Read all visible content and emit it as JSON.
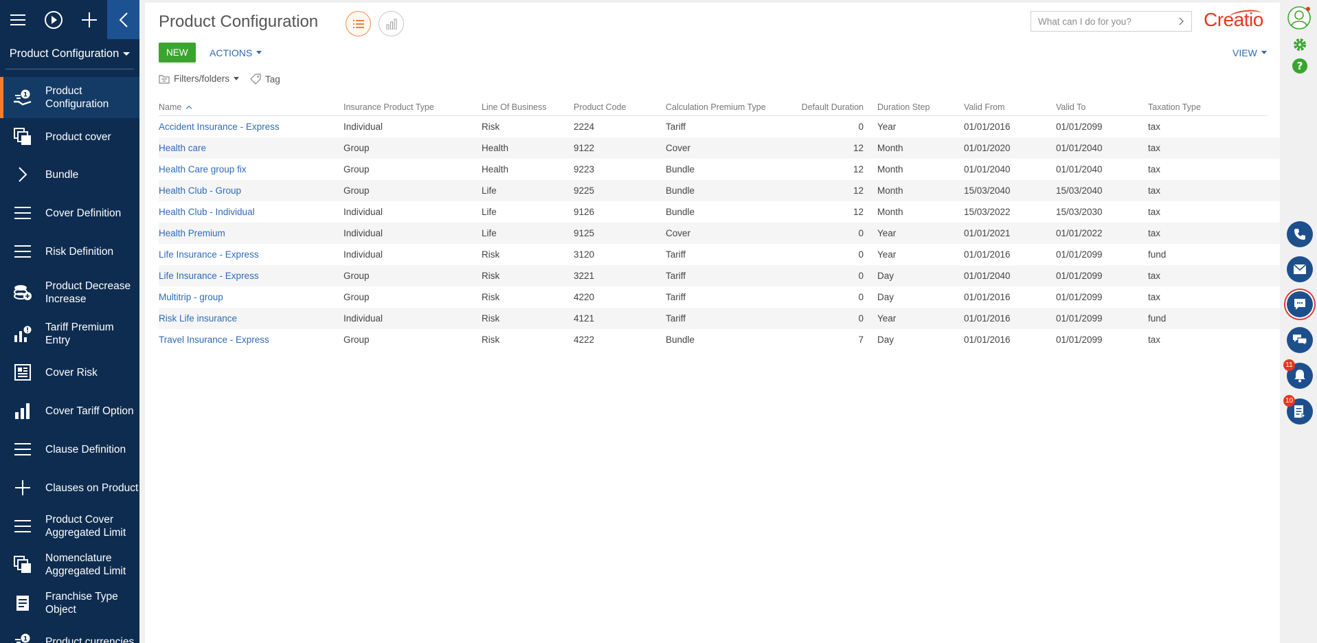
{
  "sidebar": {
    "workspace": "Product Configuration",
    "items": [
      {
        "label": "Product Configuration",
        "icon": "product-hand-icon",
        "active": true
      },
      {
        "label": "Product cover",
        "icon": "stack-icon"
      },
      {
        "label": "Bundle",
        "icon": "chevron-right-icon"
      },
      {
        "label": "Cover Definition",
        "icon": "list-icon"
      },
      {
        "label": "Risk Definition",
        "icon": "list-icon"
      },
      {
        "label": "Product Decrease Increase",
        "icon": "coins-icon"
      },
      {
        "label": "Tariff Premium Entry",
        "icon": "chart-alert-icon"
      },
      {
        "label": "Cover Risk",
        "icon": "newspaper-icon"
      },
      {
        "label": "Cover Tariff Option",
        "icon": "bar-chart-icon"
      },
      {
        "label": "Clause Definition",
        "icon": "list-icon"
      },
      {
        "label": "Clauses on Product",
        "icon": "plus-icon"
      },
      {
        "label": "Product Cover Aggregated Limit",
        "icon": "list-icon"
      },
      {
        "label": "Nomenclature Aggregated Limit",
        "icon": "stack-icon"
      },
      {
        "label": "Franchise Type Object",
        "icon": "document-icon"
      },
      {
        "label": "Product currencies",
        "icon": "product-hand-icon"
      }
    ]
  },
  "header": {
    "title": "Product Configuration",
    "search_placeholder": "What can I do for you?",
    "logo": "Creatio"
  },
  "toolbar": {
    "new_label": "NEW",
    "actions_label": "ACTIONS",
    "view_label": "VIEW",
    "filters_label": "Filters/folders",
    "tag_label": "Tag"
  },
  "grid": {
    "columns": [
      "Name",
      "Insurance Product Type",
      "Line Of Business",
      "Product Code",
      "Calculation Premium Type",
      "Default Duration",
      "Duration Step",
      "Valid From",
      "Valid To",
      "Taxation Type"
    ],
    "rows": [
      [
        "Accident Insurance - Express",
        "Individual",
        "Risk",
        "2224",
        "Tariff",
        "0",
        "Year",
        "01/01/2016",
        "01/01/2099",
        "tax"
      ],
      [
        "Health care",
        "Group",
        "Health",
        "9122",
        "Cover",
        "12",
        "Month",
        "01/01/2020",
        "01/01/2040",
        "tax"
      ],
      [
        "Health Care group fix",
        "Group",
        "Health",
        "9223",
        "Bundle",
        "12",
        "Month",
        "01/01/2040",
        "01/01/2040",
        "tax"
      ],
      [
        "Health Club - Group",
        "Group",
        "Life",
        "9225",
        "Bundle",
        "12",
        "Month",
        "15/03/2040",
        "15/03/2040",
        "tax"
      ],
      [
        "Health Club - Individual",
        "Individual",
        "Life",
        "9126",
        "Bundle",
        "12",
        "Month",
        "15/03/2022",
        "15/03/2030",
        "tax"
      ],
      [
        "Health Premium",
        "Individual",
        "Life",
        "9125",
        "Cover",
        "0",
        "Year",
        "01/01/2021",
        "01/01/2022",
        "tax"
      ],
      [
        "Life Insurance - Express",
        "Individual",
        "Risk",
        "3120",
        "Tariff",
        "0",
        "Year",
        "01/01/2016",
        "01/01/2099",
        "fund"
      ],
      [
        "Life Insurance - Express",
        "Group",
        "Risk",
        "3221",
        "Tariff",
        "0",
        "Day",
        "01/01/2040",
        "01/01/2099",
        "tax"
      ],
      [
        "Multitrip - group",
        "Group",
        "Risk",
        "4220",
        "Tariff",
        "0",
        "Day",
        "01/01/2016",
        "01/01/2099",
        "tax"
      ],
      [
        "Risk Life insurance",
        "Individual",
        "Risk",
        "4121",
        "Tariff",
        "0",
        "Year",
        "01/01/2016",
        "01/01/2099",
        "fund"
      ],
      [
        "Travel Insurance - Express",
        "Group",
        "Risk",
        "4222",
        "Bundle",
        "7",
        "Day",
        "01/01/2016",
        "01/01/2099",
        "tax"
      ]
    ]
  },
  "rightbar": {
    "notifications_badge": "11",
    "tasks_badge": "10"
  },
  "colors": {
    "sidebar_bg": "#0e2c50",
    "accent": "#ef7e33",
    "link": "#2f6ab5",
    "new_button": "#3aa52e",
    "brand": "#e8361f"
  }
}
